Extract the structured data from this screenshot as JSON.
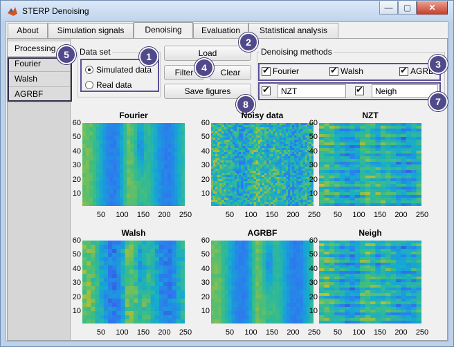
{
  "window": {
    "title": "STERP Denoising",
    "controls": {
      "minimize": "—",
      "maximize": "▢",
      "close": "✕"
    }
  },
  "tabs": [
    "About",
    "Simulation signals",
    "Denoising",
    "Evaluation",
    "Statistical analysis"
  ],
  "active_tab": "Denoising",
  "sidebar": {
    "items": [
      "Processing",
      "Fourier",
      "Walsh",
      "AGRBF"
    ],
    "active": "Processing"
  },
  "dataset": {
    "title": "Data set",
    "options": [
      {
        "label": "Simulated data",
        "selected": true
      },
      {
        "label": "Real data",
        "selected": false
      }
    ]
  },
  "buttons": {
    "load": "Load",
    "filter": "Filter",
    "clear": "Clear",
    "save_figures": "Save figures"
  },
  "methods": {
    "title": "Denoising methods",
    "row1": [
      {
        "label": "Fourier",
        "checked": true
      },
      {
        "label": "Walsh",
        "checked": true
      },
      {
        "label": "AGRBF",
        "checked": true
      }
    ],
    "row2": [
      {
        "value": "NZT",
        "checked": true
      },
      {
        "value": "Neigh",
        "checked": true
      }
    ]
  },
  "callouts": [
    "1",
    "2",
    "3",
    "4",
    "5",
    "7",
    "8"
  ],
  "plots": [
    {
      "title": "Fourier",
      "style": "smooth"
    },
    {
      "title": "Noisy data",
      "style": "noisy"
    },
    {
      "title": "NZT",
      "style": "banded"
    },
    {
      "title": "Walsh",
      "style": "blocky"
    },
    {
      "title": "AGRBF",
      "style": "smooth"
    },
    {
      "title": "Neigh",
      "style": "banded"
    }
  ],
  "axes": {
    "y_ticks": [
      "60",
      "50",
      "40",
      "30",
      "20",
      "10"
    ],
    "x_ticks": [
      "50",
      "100",
      "150",
      "200",
      "250"
    ]
  },
  "colors": {
    "callout": "#514a8a",
    "heat_low": "#3e26a8",
    "heat_mid": "#1fb8b0",
    "heat_high": "#f9fb0e"
  }
}
